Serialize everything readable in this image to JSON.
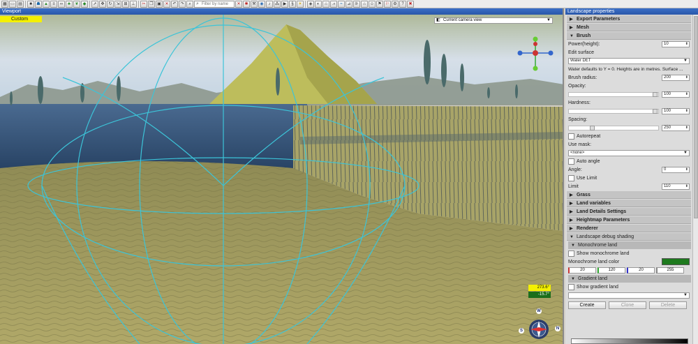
{
  "toolbar": {
    "filter_placeholder": "Filter by name"
  },
  "viewport": {
    "title": "Viewport",
    "mode_tag": "Custom",
    "camera_view": "Current camera view",
    "readout_top": "273.6°",
    "readout_bottom": "-15.7°",
    "compass": {
      "n": "N",
      "e": "E",
      "s": "S",
      "w": "W"
    },
    "colors": {
      "sky": "#c8d8e6",
      "water": "#2b4a6e",
      "terrain": "#a8a05a",
      "wire": "#3cc4d8"
    }
  },
  "props": {
    "title": "Landscape properties",
    "sections_top": [
      {
        "label": "Export Parameters",
        "state": "collapsed"
      },
      {
        "label": "Mesh",
        "state": "collapsed"
      },
      {
        "label": "Brush",
        "state": "expanded"
      }
    ],
    "brush": {
      "power_label": "Power(height):",
      "power_value": "10",
      "edit_surface_label": "Edit surface",
      "edit_surface_value": "Water DET",
      "note": "Water defaults to Y = 0. Heights are in metres. Surface ...",
      "radius_label": "Brush radius:",
      "radius_value": "200",
      "opacity_label": "Opacity:",
      "opacity_value": "100",
      "opacity_level": 1.0,
      "hardness_label": "Hardness:",
      "hardness_value": "100",
      "hardness_level": 1.0,
      "spacing_label": "Spacing:",
      "spacing_value": "250",
      "spacing_level": 0.25,
      "autorepeat_label": "Autorepeat",
      "use_mask_label": "Use mask:",
      "use_mask_value": "<none>",
      "auto_angle_label": "Auto angle",
      "angle_label": "Angle:",
      "angle_value": "0",
      "use_limit_label": "Use Limit",
      "limit_label": "Limit",
      "limit_value": "110"
    },
    "sections_mid": [
      {
        "label": "Grass",
        "state": "collapsed"
      },
      {
        "label": "Land variables",
        "state": "collapsed"
      },
      {
        "label": "Land Details Settings",
        "state": "collapsed"
      },
      {
        "label": "Heightmap Parameters",
        "state": "collapsed"
      },
      {
        "label": "Renderer",
        "state": "collapsed"
      },
      {
        "label": "Landscape debug shading",
        "state": "expanded"
      }
    ],
    "monochrome": {
      "title": "Monochrome land",
      "show_label": "Show monochrome land",
      "color_label": "Monochrome land color",
      "color": "#1e7a1e",
      "r": "20",
      "g": "120",
      "b": "20",
      "a": "255"
    },
    "gradient": {
      "title": "Gradient land",
      "show_label": "Show gradient land",
      "create_label": "Create",
      "clone_label": "Clone",
      "delete_label": "Delete"
    }
  }
}
